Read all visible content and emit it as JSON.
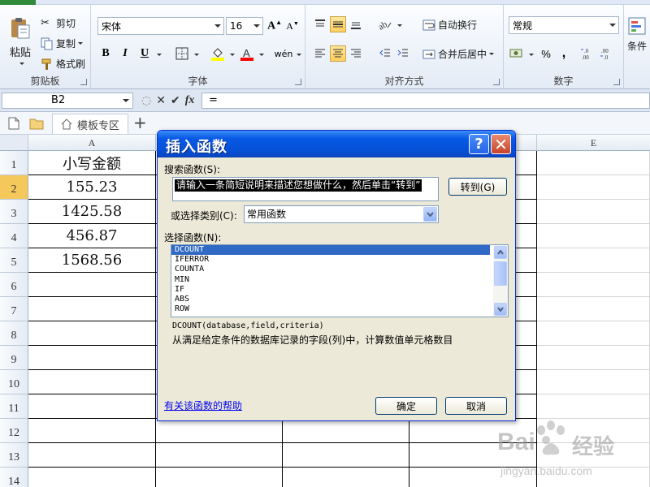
{
  "ribbon": {
    "clipboard": {
      "paste_label": "粘贴",
      "cut_label": "剪切",
      "copy_label": "复制",
      "format_painter_label": "格式刷",
      "group_label": "剪贴板"
    },
    "font": {
      "font_name": "宋体",
      "font_size": "16",
      "bold": "B",
      "italic": "I",
      "underline": "U",
      "phonetic": "wén",
      "group_label": "字体"
    },
    "alignment": {
      "wrap_text_label": "自动换行",
      "merge_center_label": "合并后居中",
      "group_label": "对齐方式"
    },
    "number": {
      "format_value": "常规",
      "percent": "%",
      "comma": ",",
      "group_label": "数字"
    },
    "styles": {
      "conditional_label": "条件"
    }
  },
  "formula_bar": {
    "name_box": "B2",
    "formula": "="
  },
  "tabs": {
    "template_tab": "模板专区",
    "add_tab": "+"
  },
  "sheet": {
    "columns": [
      "A",
      "E"
    ],
    "rows": [
      "1",
      "2",
      "3",
      "4",
      "5",
      "6",
      "7",
      "8",
      "9",
      "10",
      "11",
      "12",
      "13",
      "14"
    ],
    "active_row": "2",
    "column_a_values": [
      "小写金额",
      "155.23",
      "1425.58",
      "456.87",
      "1568.56"
    ]
  },
  "dialog": {
    "title": "插入函数",
    "help_btn": "?",
    "close_btn": "✕",
    "search_label": "搜索函数(S):",
    "search_value": "请输入一条简短说明来描述您想做什么，然后单击“转到”",
    "goto_button": "转到(G)",
    "category_label": "或选择类别(C):",
    "category_value": "常用函数",
    "select_label": "选择函数(N):",
    "functions": [
      "DCOUNT",
      "IFERROR",
      "COUNTA",
      "MIN",
      "IF",
      "ABS",
      "ROW"
    ],
    "selected_function": "DCOUNT",
    "signature": "DCOUNT(database,field,criteria)",
    "description": "从满足给定条件的数据库记录的字段(列)中，计算数值单元格数目",
    "help_link": "有关该函数的帮助",
    "ok_button": "确定",
    "cancel_button": "取消"
  },
  "watermark": {
    "text": "Bai",
    "subtext": "经验",
    "url": "jingyan.baidu.com"
  },
  "colors": {
    "titlebar": "#0552d8",
    "dialog_bg": "#ece9d8",
    "selection": "#316ac5",
    "active_row_header": "#f5c85b",
    "ribbon_bg": "#e3ebf6"
  }
}
